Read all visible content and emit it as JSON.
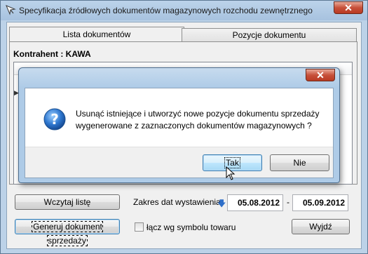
{
  "window": {
    "title": "Specyfikacja źródłowych dokumentów magazynowych rozchodu zewnętrznego",
    "close_label": "✕"
  },
  "tabs": [
    {
      "label": "Lista dokumentów",
      "active": true
    },
    {
      "label": "Pozycje dokumentu",
      "active": false
    }
  ],
  "contractor": {
    "label": "Kontrahent : KAWA"
  },
  "footer": {
    "load_button": "Wczytaj listę",
    "date_range_label": "Zakres dat wystawienia",
    "date_from": "05.08.2012",
    "date_separator": "-",
    "date_to": "05.09.2012",
    "generate_button": "Generuj dokument sprzedaży",
    "merge_checkbox_label": "łącz wg symbolu towaru",
    "merge_checked": false,
    "exit_button": "Wyjdź"
  },
  "dialog": {
    "close_label": "✕",
    "message_line1": "Usunąć istniejące i utworzyć nowe pozycje dokumentu sprzedaży",
    "message_line2": "wygenerowane z zaznaczonych dokumentów magazynowych ?",
    "yes_button": "Tak",
    "no_button": "Nie"
  },
  "icons": {
    "app": "app-arrow-icon",
    "question": "question-icon",
    "sort": "sort-down-arrow-icon",
    "cursor": "mouse-cursor-icon"
  },
  "colors": {
    "title_bar": "#a7c2df",
    "close_red": "#c7503a",
    "question_blue": "#1f5fb5",
    "focus_blue": "#3c7fb1"
  }
}
